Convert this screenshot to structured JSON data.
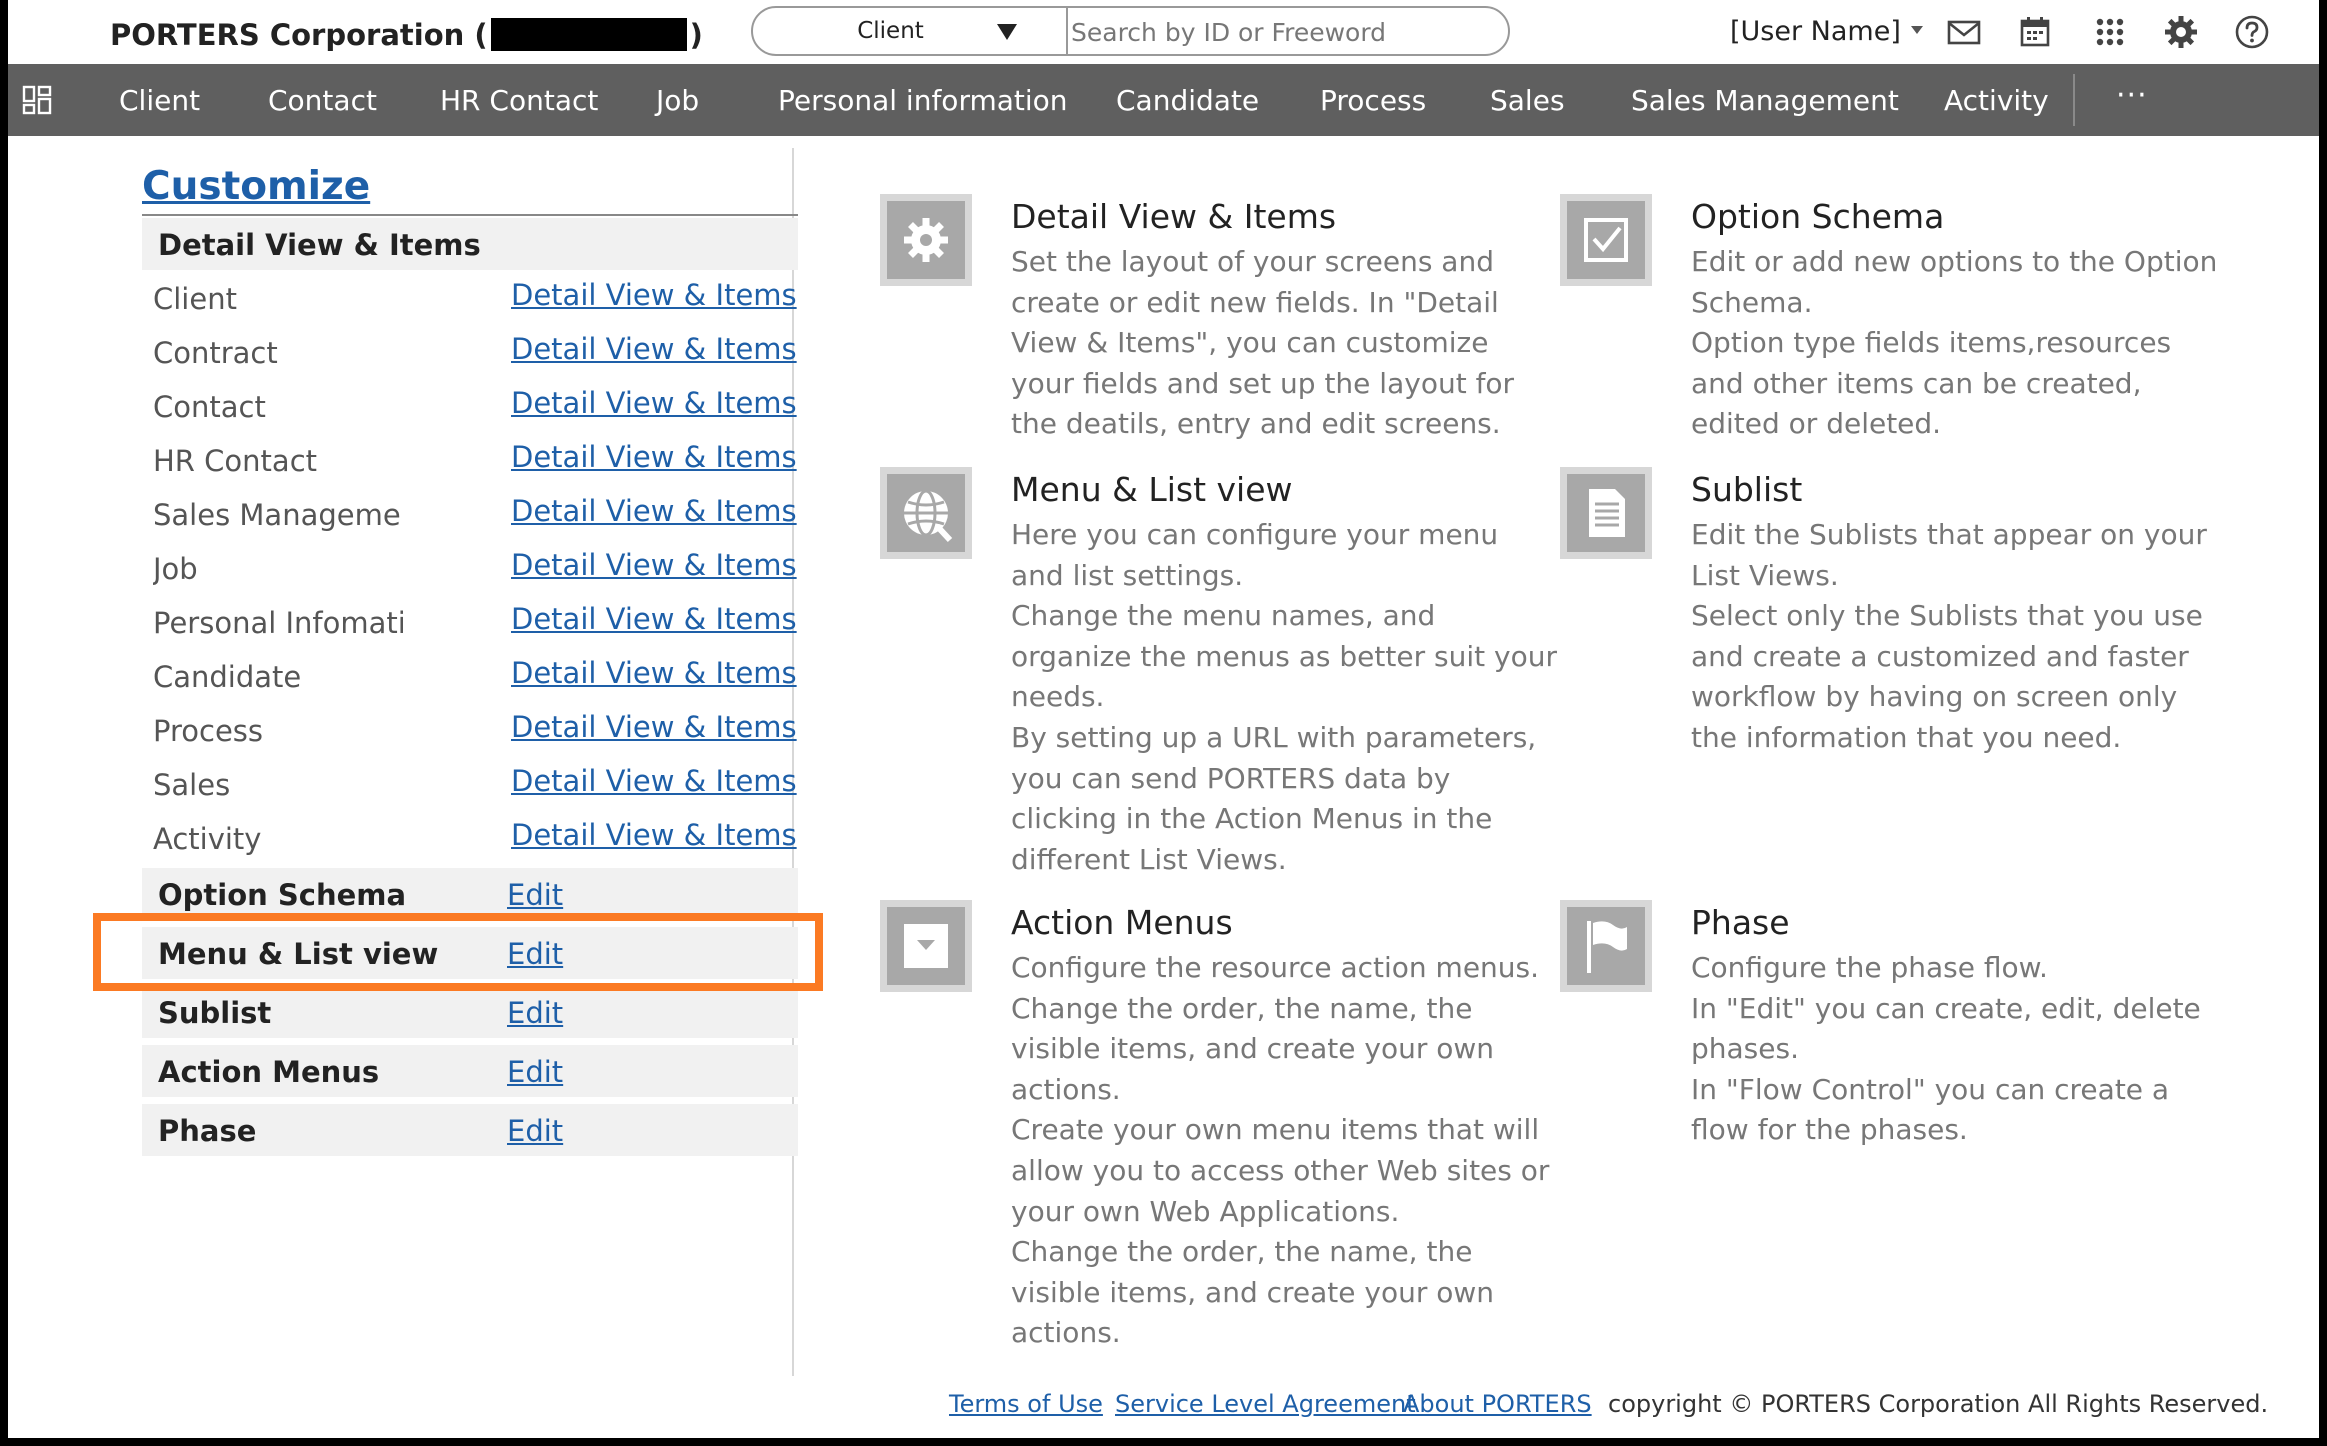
{
  "header": {
    "company_prefix": "PORTERS Corporation (",
    "company_suffix": ")",
    "resource_select": "Client",
    "search_placeholder": "Search by ID or Freeword",
    "user_name": "[User Name]"
  },
  "nav": {
    "items": [
      "Client",
      "Contact",
      "HR Contact",
      "Job",
      "Personal information",
      "Candidate",
      "Process",
      "Sales",
      "Sales Management",
      "Activity"
    ],
    "more": "···"
  },
  "sidebar": {
    "title": "Customize",
    "detail_header": "Detail View & Items",
    "resource_rows": [
      {
        "label": "Client",
        "link": "Detail View & Items"
      },
      {
        "label": "Contract",
        "link": "Detail View & Items"
      },
      {
        "label": "Contact",
        "link": "Detail View & Items"
      },
      {
        "label": "HR Contact",
        "link": "Detail View & Items"
      },
      {
        "label": "Sales Management",
        "link": "Detail View & Items"
      },
      {
        "label": "Job",
        "link": "Detail View & Items"
      },
      {
        "label": "Personal Infomati···",
        "link": "Detail View & Items"
      },
      {
        "label": "Candidate",
        "link": "Detail View & Items"
      },
      {
        "label": "Process",
        "link": "Detail View & Items"
      },
      {
        "label": "Sales",
        "link": "Detail View & Items"
      },
      {
        "label": "Activity",
        "link": "Detail View & Items"
      }
    ],
    "sections": [
      {
        "label": "Option Schema",
        "link": "Edit"
      },
      {
        "label": "Menu & List view",
        "link": "Edit"
      },
      {
        "label": "Sublist",
        "link": "Edit"
      },
      {
        "label": "Action Menus",
        "link": "Edit"
      },
      {
        "label": "Phase",
        "link": "Edit"
      }
    ]
  },
  "info": [
    {
      "title": "Detail View & Items",
      "icon": "gear-icon",
      "desc": "Set the layout of your screens and\ncreate or edit new fields. In \"Detail\nView & Items\", you can customize\nyour fields and set up the layout for\nthe deatils, entry and edit screens."
    },
    {
      "title": "Option Schema",
      "icon": "checkbox-icon",
      "desc": "Edit or add new options to the Option\nSchema.\nOption type fields items,resources\nand other items can be created,\nedited or deleted."
    },
    {
      "title": "Menu & List view",
      "icon": "globe-icon",
      "desc": "Here you can configure your menu\nand list settings.\nChange the menu names, and\norganize the menus as better suit your\nneeds.\nBy setting up a URL with parameters,\nyou can send PORTERS data by\nclicking in the Action Menus in the\ndifferent List Views."
    },
    {
      "title": "Sublist",
      "icon": "document-icon",
      "desc": "Edit the Sublists that appear on your\nList Views.\nSelect only the Sublists that you use\nand create a customized and faster\nworkflow by having on screen only\nthe information that you need."
    },
    {
      "title": "Action Menus",
      "icon": "dropdown-icon",
      "desc": "Configure the resource action menus.\nChange the order, the name, the\nvisible items, and create your own\nactions.\nCreate your own menu items that will\nallow you to access other Web sites or\nyour own Web Applications.\nChange the order, the name, the\nvisible items, and create your own\nactions."
    },
    {
      "title": "Phase",
      "icon": "flag-icon",
      "desc": "Configure the phase flow.\nIn \"Edit\" you can create, edit, delete\nphases.\nIn \"Flow Control\" you can create a\nflow for the phases."
    }
  ],
  "footer": {
    "links": [
      "Terms of Use",
      "Service Level Agreement",
      "About PORTERS"
    ],
    "copyright": "copyright © PORTERS Corporation All Rights Reserved."
  },
  "colors": {
    "nav_bg": "#5f5f5f",
    "link": "#1e5fa8",
    "highlight": "#fb7a23",
    "section_bg": "#f1f1f1"
  }
}
